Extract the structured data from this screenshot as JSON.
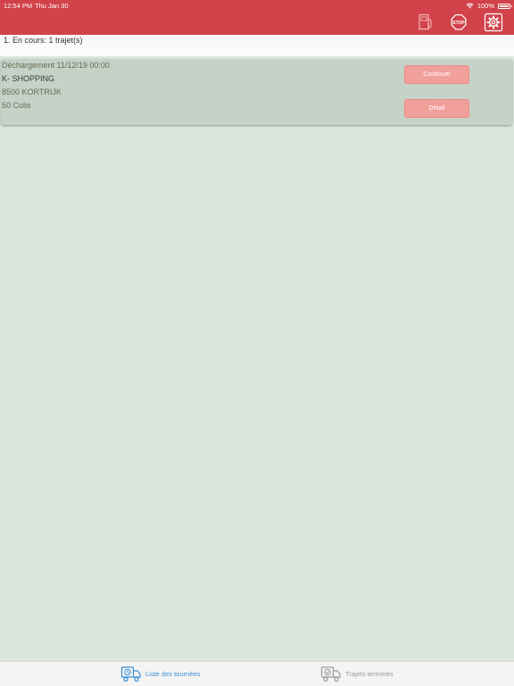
{
  "status_bar": {
    "time": "12:54 PM",
    "date": "Thu Jan 30",
    "battery": "100%"
  },
  "header": {
    "icons": [
      "fuel-icon",
      "stop-sign-icon",
      "settings-gear-icon"
    ]
  },
  "subheader": {
    "text": "1. En cours: 1 trajet(s)"
  },
  "trips": [
    {
      "line1": "Déchargement 11/12/19 00:00",
      "line2": "K- SHOPPING",
      "line3": "8500 KORTRIJK",
      "line4": "50 Colis",
      "continue_label": "Continuer",
      "detail_label": "Détail"
    }
  ],
  "tabs": [
    {
      "label": "Liste des tournées",
      "active": true
    },
    {
      "label": "Trajets terminés",
      "active": false
    }
  ],
  "colors": {
    "header": "#d1424a",
    "background": "#d9e7dd",
    "card": "#c4d2c7",
    "button": "#f19f9b",
    "tab_active": "#3a8fd6"
  }
}
